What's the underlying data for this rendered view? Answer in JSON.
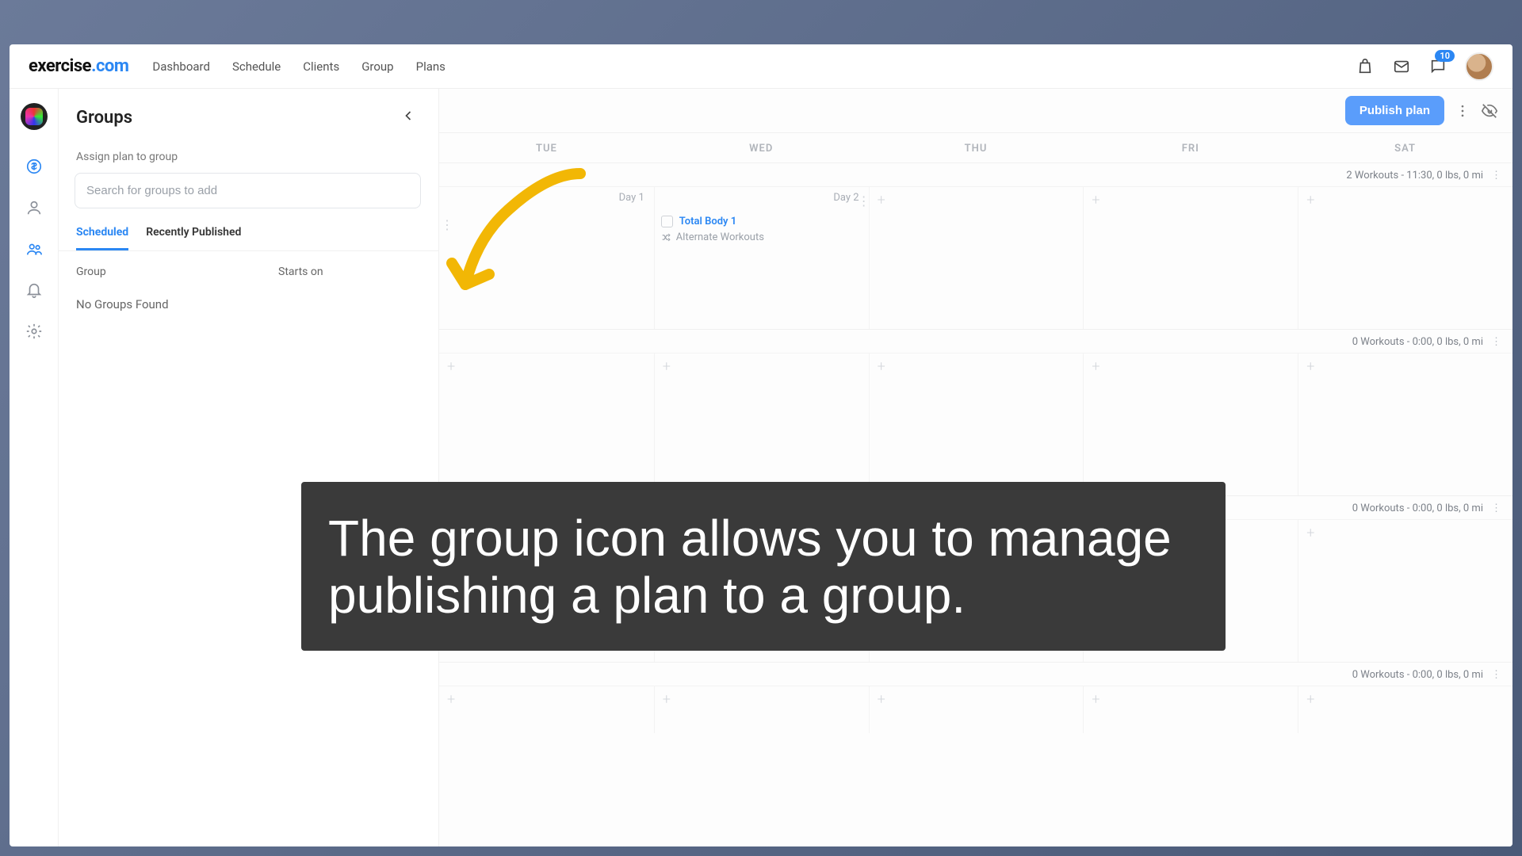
{
  "logo": {
    "part1": "exercise",
    "part2": ".com"
  },
  "nav": {
    "dashboard": "Dashboard",
    "schedule": "Schedule",
    "clients": "Clients",
    "group": "Group",
    "plans": "Plans"
  },
  "notifications": {
    "chat_count": "10"
  },
  "side": {
    "title": "Groups",
    "assign_label": "Assign plan to group",
    "search_placeholder": "Search for groups to add",
    "tabs": {
      "scheduled": "Scheduled",
      "recent": "Recently Published"
    },
    "col_group": "Group",
    "col_starts": "Starts on",
    "empty": "No Groups Found"
  },
  "cal": {
    "publish": "Publish plan",
    "days": {
      "tue": "TUE",
      "wed": "WED",
      "thu": "THU",
      "fri": "FRI",
      "sat": "SAT"
    },
    "week1": {
      "summary": "2 Workouts - 11:30, 0 lbs, 0 mi",
      "day1_label": "Day 1",
      "day2_label": "Day 2",
      "workout_title": "Total Body 1",
      "workout_sub": "Alternate Workouts"
    },
    "week2": {
      "summary": "0 Workouts - 0:00, 0 lbs, 0 mi"
    },
    "week3": {
      "summary": "0 Workouts - 0:00, 0 lbs, 0 mi"
    },
    "week4": {
      "summary": "0 Workouts - 0:00, 0 lbs, 0 mi"
    }
  },
  "caption": "The group icon allows you to manage publishing a plan to a group."
}
